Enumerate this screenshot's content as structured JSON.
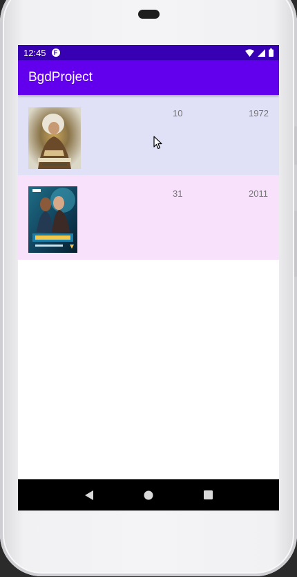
{
  "status_bar": {
    "time": "12:45",
    "app_icon": "F",
    "background": "#3700b3",
    "icons": [
      "wifi-icon",
      "cell-signal-icon",
      "battery-icon"
    ]
  },
  "app_bar": {
    "title": "BgdProject",
    "background": "#6200ee"
  },
  "list": {
    "items": [
      {
        "number": "10",
        "year": "1972",
        "background": "#e0e0f6",
        "image": "doctor-who-dvd-cover-1972"
      },
      {
        "number": "31",
        "year": "2011",
        "background": "#f7e1fb",
        "image": "doctor-who-dvd-cover-2011"
      }
    ]
  },
  "nav_bar": {
    "background": "#000000",
    "icons": [
      "back-icon",
      "home-icon",
      "recents-icon"
    ]
  }
}
